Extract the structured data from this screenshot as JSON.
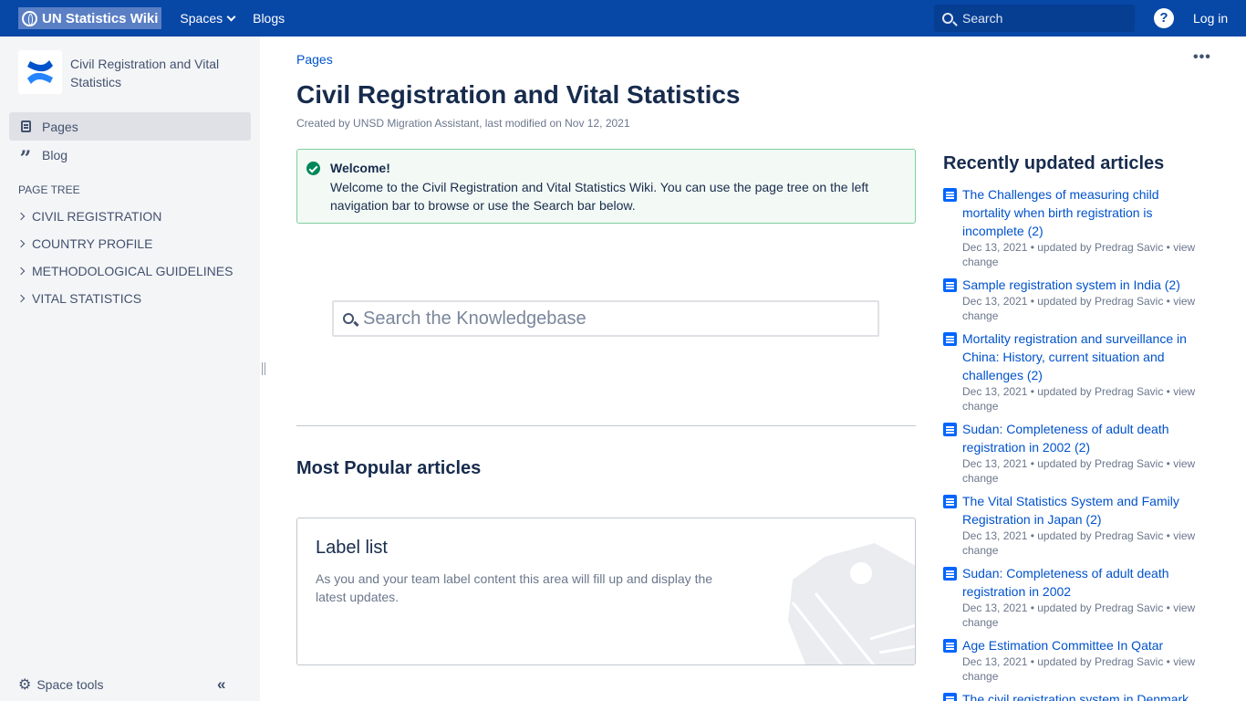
{
  "topnav": {
    "logo": "UN Statistics Wiki",
    "spaces": "Spaces",
    "blogs": "Blogs",
    "search_placeholder": "Search",
    "help": "?",
    "login": "Log in"
  },
  "sidebar": {
    "space_name": "Civil Registration and Vital Statistics",
    "nav": [
      {
        "label": "Pages",
        "icon": "page-icon",
        "active": true
      },
      {
        "label": "Blog",
        "icon": "quote-icon",
        "active": false
      }
    ],
    "tree_heading": "PAGE TREE",
    "tree": [
      {
        "label": "CIVIL REGISTRATION"
      },
      {
        "label": "COUNTRY PROFILE"
      },
      {
        "label": "METHODOLOGICAL GUIDELINES"
      },
      {
        "label": "VITAL STATISTICS"
      }
    ],
    "space_tools": "Space tools",
    "collapse": "«"
  },
  "main": {
    "breadcrumb": "Pages",
    "title": "Civil Registration and Vital Statistics",
    "byline": "Created by UNSD Migration Assistant, last modified on Nov 12, 2021",
    "info": {
      "title": "Welcome!",
      "text": "Welcome to the Civil Registration and Vital Statistics Wiki. You can use the page tree on the left navigation bar to browse or use the Search bar below."
    },
    "kb_search_placeholder": "Search the Knowledgebase",
    "popular_heading": "Most Popular articles",
    "label_list": {
      "title": "Label list",
      "text": "As you and your team label content this area will fill up and display the latest updates."
    }
  },
  "recent": {
    "heading": "Recently updated articles",
    "items": [
      {
        "title": "The Challenges of measuring child mortality when birth registration is incomplete (2)",
        "meta": "Dec 13, 2021 • updated by Predrag Savic • view change"
      },
      {
        "title": "Sample registration system in India (2)",
        "meta": "Dec 13, 2021 • updated by Predrag Savic • view change"
      },
      {
        "title": "Mortality registration and surveillance in China: History, current situation and challenges (2)",
        "meta": "Dec 13, 2021 • updated by Predrag Savic • view change"
      },
      {
        "title": "Sudan: Completeness of adult death registration in 2002 (2)",
        "meta": "Dec 13, 2021 • updated by Predrag Savic • view change"
      },
      {
        "title": "The Vital Statistics System and Family Registration in Japan (2)",
        "meta": "Dec 13, 2021 • updated by Predrag Savic • view change"
      },
      {
        "title": "Sudan: Completeness of adult death registration in 2002",
        "meta": "Dec 13, 2021 • updated by Predrag Savic • view change"
      },
      {
        "title": "Age Estimation Committee In Qatar",
        "meta": "Dec 13, 2021 • updated by Predrag Savic • view change"
      },
      {
        "title": "The civil registration system in Denmark",
        "meta": ""
      }
    ]
  },
  "colors": {
    "nav_bg": "#0747a6",
    "sidebar_bg": "#f4f5f7",
    "link": "#0052cc",
    "success": "#00875a"
  }
}
